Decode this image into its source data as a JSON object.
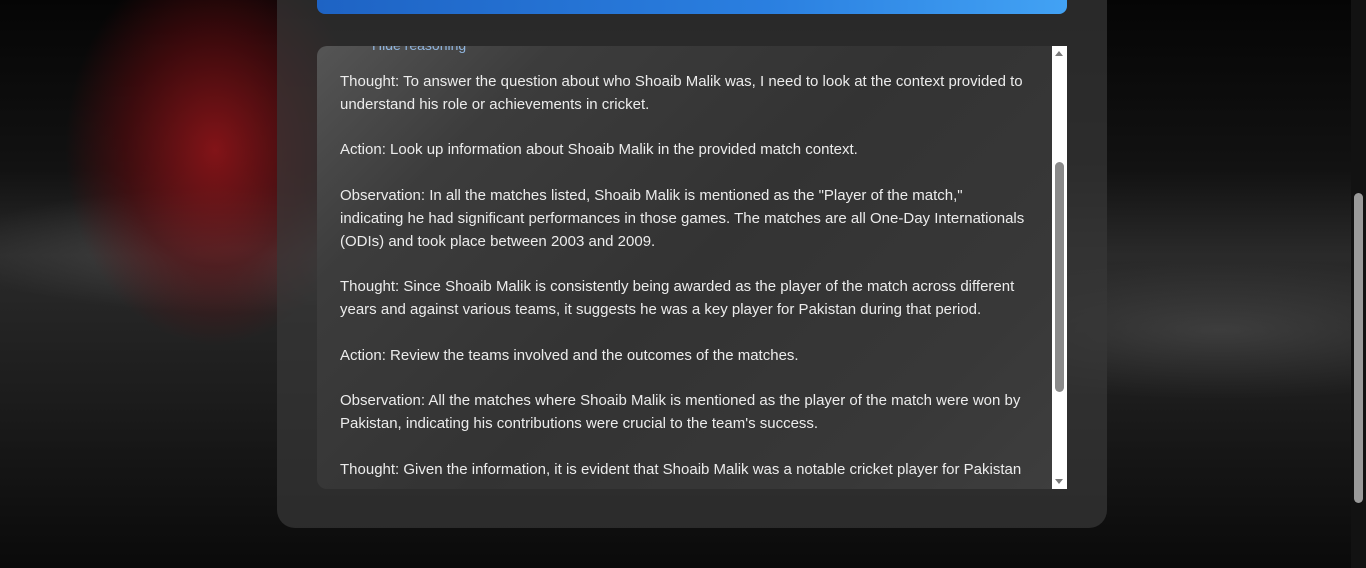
{
  "panel": {
    "toggle_label": "Hide reasoning",
    "paragraphs": [
      "Thought: To answer the question about who Shoaib Malik was, I need to look at the context provided to understand his role or achievements in cricket.",
      "Action: Look up information about Shoaib Malik in the provided match context.",
      "Observation: In all the matches listed, Shoaib Malik is mentioned as the \"Player of the match,\" indicating he had significant performances in those games. The matches are all One-Day Internationals (ODIs) and took place between 2003 and 2009.",
      "Thought: Since Shoaib Malik is consistently being awarded as the player of the match across different years and against various teams, it suggests he was a key player for Pakistan during that period.",
      "Action: Review the teams involved and the outcomes of the matches.",
      "Observation: All the matches where Shoaib Malik is mentioned as the player of the match were won by Pakistan, indicating his contributions were crucial to the team's success.",
      "Thought: Given the information, it is evident that Shoaib Malik was a notable cricket player for Pakistan"
    ]
  }
}
